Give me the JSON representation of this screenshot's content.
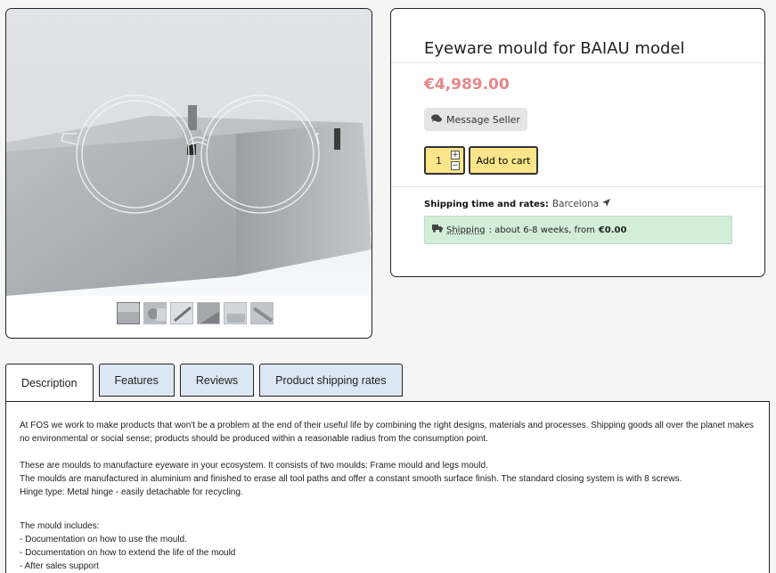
{
  "product": {
    "title": "Eyeware mould for BAIAU model",
    "price": "€4,989.00",
    "message_seller_label": "Message Seller",
    "quantity": "1",
    "qty_plus": "+",
    "qty_minus": "−",
    "add_to_cart_label": "Add to cart"
  },
  "shipping": {
    "label": "Shipping time and rates:",
    "location": "Barcelona",
    "link": "Shipping",
    "estimate": ": about 6-8 weeks, from",
    "cost": "€0.00"
  },
  "gallery": {
    "thumbnail_count": 6
  },
  "tabs": [
    {
      "label": "Description"
    },
    {
      "label": "Features"
    },
    {
      "label": "Reviews"
    },
    {
      "label": "Product shipping rates"
    }
  ],
  "description": {
    "p1": "At FOS we work to make products that won't be a problem at the end of their useful life by combining the right designs, materials and processes. Shipping goods all over the planet makes no environmental or social sense; products should be produced within a reasonable radius from the consumption point.",
    "p2_l1": "These are moulds to manufacture eyeware in your ecosystem. It consists of two moulds: Frame mould and legs mould.",
    "p2_l2": "The moulds are manufactured in aluminium and finished to erase all tool paths and offer a constant smooth surface finish. The standard closing system is with 8 screws.",
    "p2_l3": "Hinge type: Metal hinge - easily detachable for recycling.",
    "p3_l1": "The mould includes:",
    "p3_l2": "- Documentation on how to use the mould.",
    "p3_l3": "- Documentation on how to extend the life of the mould",
    "p3_l4": "- After sales support"
  },
  "colors": {
    "price": "#e8868a",
    "cart_button": "#fbe58a",
    "shipping_box": "#d2eed8",
    "tab_inactive": "#dbe8f3"
  },
  "icons": [
    "chat-bubbles-icon",
    "location-arrow-icon",
    "truck-icon"
  ]
}
